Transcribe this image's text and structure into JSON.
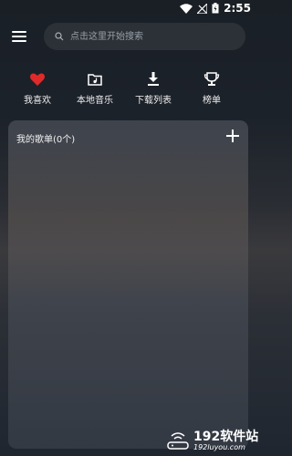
{
  "status_bar": {
    "time": "2:55"
  },
  "search": {
    "placeholder": "点击这里开始搜索"
  },
  "nav": [
    {
      "label": "我喜欢",
      "icon": "heart-icon"
    },
    {
      "label": "本地音乐",
      "icon": "local-folder-icon"
    },
    {
      "label": "下载列表",
      "icon": "download-icon"
    },
    {
      "label": "榜单",
      "icon": "trophy-icon"
    }
  ],
  "playlist_card": {
    "title": "我的歌单(0个)"
  },
  "watermark": {
    "main": "192软件站",
    "sub": "192luyou.com"
  },
  "colors": {
    "heart": "#e02a2a",
    "text": "#ffffff"
  }
}
